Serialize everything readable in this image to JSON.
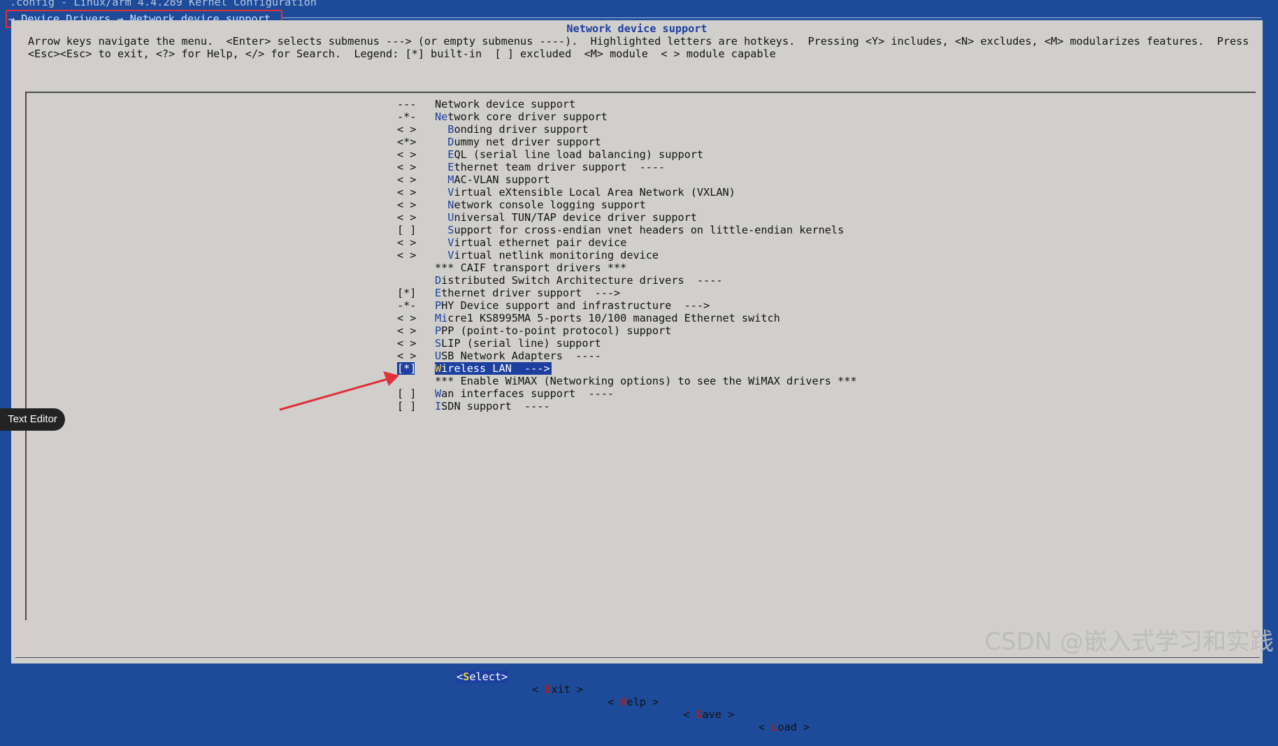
{
  "window": {
    "title": ".config - Linux/arm 4.4.289 Kernel Configuration",
    "breadcrumb": "→ Device Drivers → Network device support"
  },
  "dialog": {
    "title": "Network device support",
    "help_line1": "Arrow keys navigate the menu.  <Enter> selects submenus ---> (or empty submenus ----).  Highlighted letters are hotkeys.  Pressing <Y> includes, <N> excludes, <M> modularizes features.  Press",
    "help_line2": "<Esc><Esc> to exit, <?> for Help, </> for Search.  Legend: [*] built-in  [ ] excluded  <M> module  < > module capable"
  },
  "menu": {
    "items": [
      {
        "mark": "---",
        "indent": "",
        "hot": "",
        "rest": "Network device support"
      },
      {
        "mark": "-*-",
        "indent": "",
        "hot": "Ne",
        "rest": "twork core driver support"
      },
      {
        "mark": "< >",
        "indent": "  ",
        "hot": "B",
        "rest": "onding driver support"
      },
      {
        "mark": "<*>",
        "indent": "  ",
        "hot": "D",
        "rest": "ummy net driver support"
      },
      {
        "mark": "< >",
        "indent": "  ",
        "hot": "E",
        "rest": "QL (serial line load balancing) support"
      },
      {
        "mark": "< >",
        "indent": "  ",
        "hot": "E",
        "rest": "thernet team driver support  ----"
      },
      {
        "mark": "< >",
        "indent": "  ",
        "hot": "M",
        "rest": "AC-VLAN support"
      },
      {
        "mark": "< >",
        "indent": "  ",
        "hot": "V",
        "rest": "irtual eXtensible Local Area Network (VXLAN)"
      },
      {
        "mark": "< >",
        "indent": "  ",
        "hot": "N",
        "rest": "etwork console logging support"
      },
      {
        "mark": "< >",
        "indent": "  ",
        "hot": "U",
        "rest": "niversal TUN/TAP device driver support"
      },
      {
        "mark": "[ ]",
        "indent": "  ",
        "hot": "S",
        "rest": "upport for cross-endian vnet headers on little-endian kernels"
      },
      {
        "mark": "< >",
        "indent": "  ",
        "hot": "V",
        "rest": "irtual ethernet pair device"
      },
      {
        "mark": "< >",
        "indent": "  ",
        "hot": "V",
        "rest": "irtual netlink monitoring device"
      },
      {
        "mark": "",
        "indent": "",
        "hot": "",
        "rest": "*** CAIF transport drivers ***"
      },
      {
        "mark": "",
        "indent": "",
        "hot": "D",
        "rest": "istributed Switch Architecture drivers  ----"
      },
      {
        "mark": "[*]",
        "indent": "",
        "hot": "E",
        "rest": "thernet driver support  --->"
      },
      {
        "mark": "-*-",
        "indent": "",
        "hot": "P",
        "rest": "HY Device support and infrastructure  --->"
      },
      {
        "mark": "< >",
        "indent": "",
        "hot": "Mi",
        "rest": "cre1 KS8995MA 5-ports 10/100 managed Ethernet switch"
      },
      {
        "mark": "< >",
        "indent": "",
        "hot": "P",
        "rest": "PP (point-to-point protocol) support"
      },
      {
        "mark": "< >",
        "indent": "",
        "hot": "S",
        "rest": "LIP (serial line) support"
      },
      {
        "mark": "< >",
        "indent": "",
        "hot": "U",
        "rest": "SB Network Adapters  ----"
      },
      {
        "mark": "[*]",
        "indent": "",
        "hot": "W",
        "rest": "ireless LAN  --->",
        "selected": true
      },
      {
        "mark": "",
        "indent": "",
        "hot": "",
        "rest": "*** Enable WiMAX (Networking options) to see the WiMAX drivers ***"
      },
      {
        "mark": "[ ]",
        "indent": "",
        "hot": "W",
        "rest": "an interfaces support  ----"
      },
      {
        "mark": "[ ]",
        "indent": "",
        "hot": "I",
        "rest": "SDN support  ----"
      }
    ]
  },
  "buttons": {
    "select": {
      "pre": "<",
      "hot": "S",
      "post": "elect>"
    },
    "exit": {
      "pre": "< ",
      "hot": "E",
      "post": "xit >"
    },
    "help": {
      "pre": "< ",
      "hot": "H",
      "post": "elp >"
    },
    "save": {
      "pre": "< ",
      "hot": "S",
      "post": "ave >"
    },
    "load": {
      "pre": "< ",
      "hot": "L",
      "post": "oad >"
    }
  },
  "tooltip": {
    "text": "Text Editor"
  },
  "watermark": {
    "text": "CSDN @嵌入式学习和实践"
  },
  "colors": {
    "terminal_bg": "#1d4b9a",
    "dialog_bg": "#d0cfcc",
    "highlight": "#1c3fa0",
    "annotation": "#e0303a"
  },
  "icons": {
    "annotation_arrow": "red-arrow-icon"
  }
}
